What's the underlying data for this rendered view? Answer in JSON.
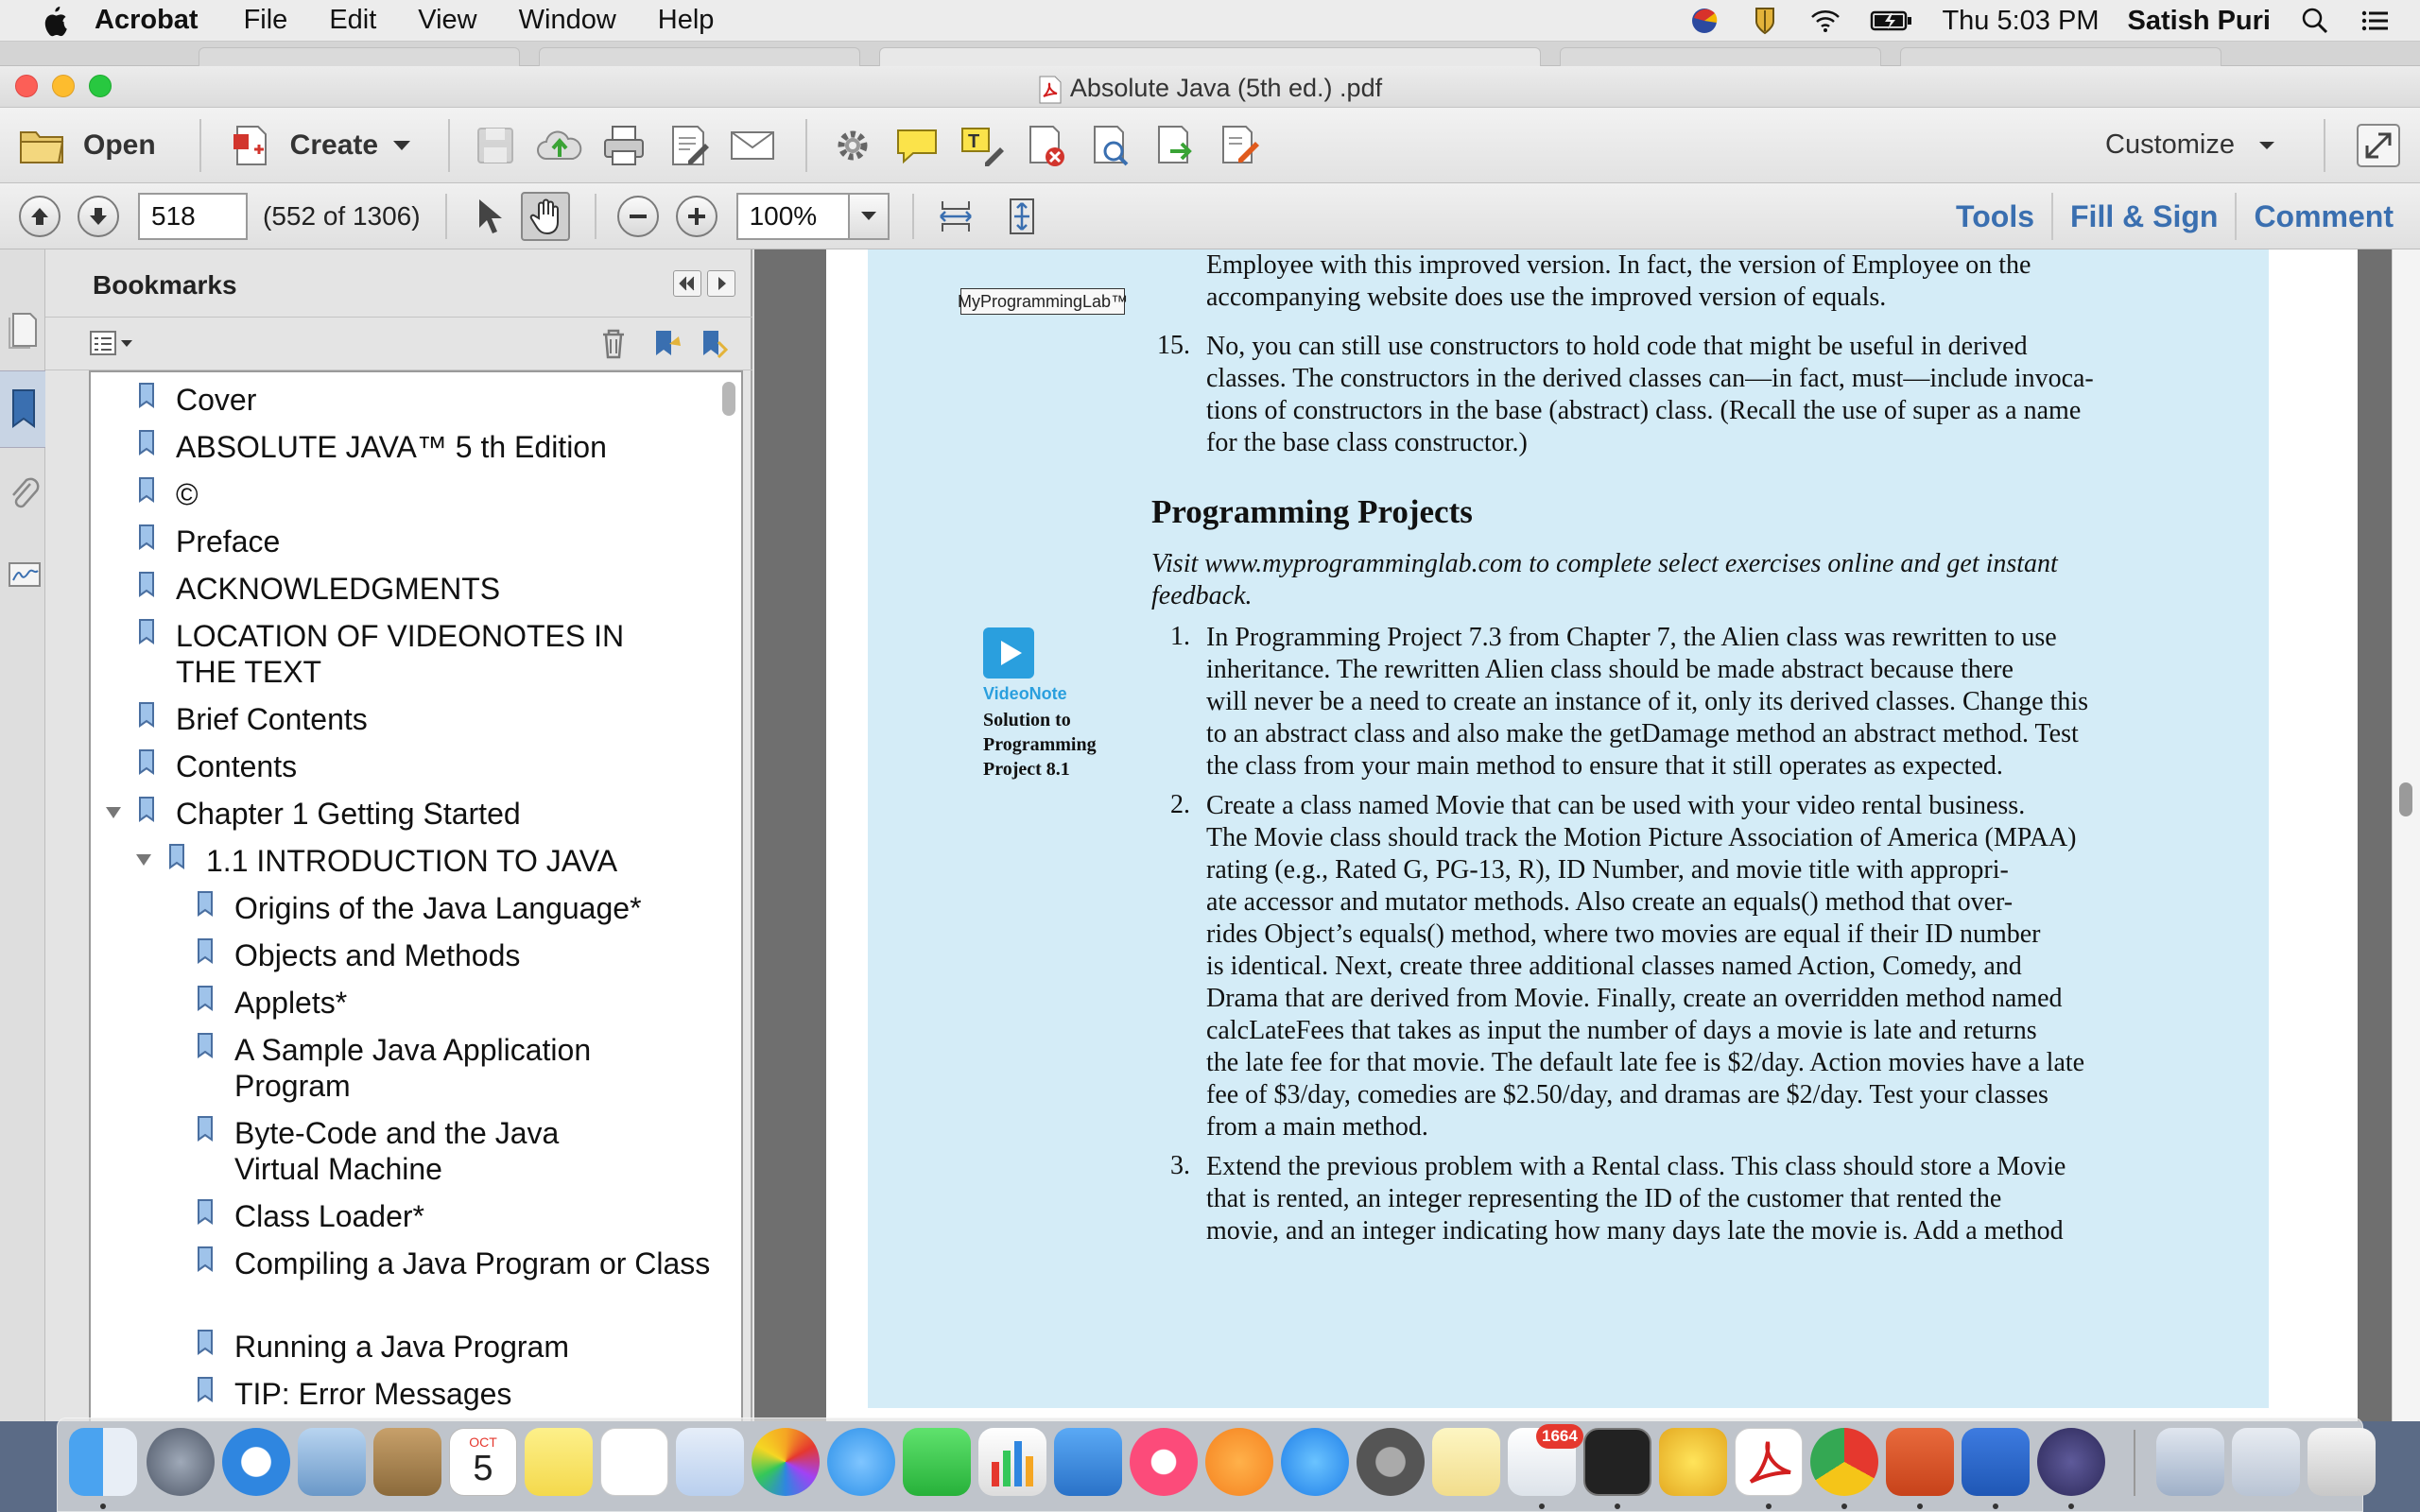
{
  "menubar": {
    "app": "Acrobat",
    "items": [
      "File",
      "Edit",
      "View",
      "Window",
      "Help"
    ],
    "clock": "Thu 5:03 PM",
    "user": "Satish Puri"
  },
  "window": {
    "title": "Absolute Java (5th ed.) .pdf"
  },
  "toolbar": {
    "open_label": "Open",
    "create_label": "Create",
    "customize_label": "Customize"
  },
  "nav": {
    "page_value": "518",
    "page_count": "(552 of 1306)",
    "zoom": "100%",
    "tools": "Tools",
    "fill_sign": "Fill & Sign",
    "comment": "Comment"
  },
  "bookmarks": {
    "title": "Bookmarks",
    "items": [
      {
        "label": "Cover"
      },
      {
        "label": "ABSOLUTE JAVA™ 5 th Edition"
      },
      {
        "label": "©"
      },
      {
        "label": "Preface"
      },
      {
        "label": "ACKNOWLEDGMENTS"
      },
      {
        "label": "LOCATION OF VIDEONOTES IN THE TEXT"
      },
      {
        "label": "Brief Contents"
      },
      {
        "label": "Contents"
      },
      {
        "label": "Chapter 1 Getting Started"
      },
      {
        "label": "1.1 INTRODUCTION TO JAVA"
      },
      {
        "label": "Origins of the Java Language*"
      },
      {
        "label": "Objects and Methods"
      },
      {
        "label": "Applets*"
      },
      {
        "label": "A Sample Java Application Program"
      },
      {
        "label": "Byte-Code and the Java Virtual Machine"
      },
      {
        "label": "Class Loader*"
      },
      {
        "label": "Compiling a Java Program or Class"
      },
      {
        "label": "Running a Java Program"
      },
      {
        "label": "TIP: Error Messages"
      }
    ]
  },
  "doc": {
    "top_line1": "Employee with this improved version. In fact, the version of Employee on the",
    "top_line2": "accompanying website does use the improved version of equals.",
    "item15_num": "15.",
    "item15": [
      "No, you can still use constructors to hold code that might be useful in derived",
      "classes. The constructors in the derived classes can—in fact, must—include invoca-",
      "tions of constructors in the base (abstract) class. (Recall the use of super as a name",
      "for the base class constructor.)"
    ],
    "logo": "MyProgrammingLab™",
    "heading": "Programming Projects",
    "intro": [
      "Visit www.myprogramminglab.com to complete select exercises online and get instant",
      "feedback."
    ],
    "videonote_label": "VideoNote",
    "videonote_desc": "Solution to Programming Project 8.1",
    "p1_num": "1.",
    "p1": [
      "In Programming Project 7.3 from Chapter 7, the Alien class was rewritten to use",
      "inheritance. The rewritten Alien class should be made abstract because there",
      "will never be a need to create an instance of it, only its derived classes. Change this",
      "to an abstract class and also make the getDamage method an abstract method. Test",
      "the class from your main method to ensure that it still operates as expected."
    ],
    "p2_num": "2.",
    "p2": [
      "Create a class named Movie that can be used with your video rental business.",
      "The Movie class should track the Motion Picture Association of America (MPAA)",
      "rating (e.g., Rated G, PG-13, R), ID Number, and movie title with appropri-",
      "ate accessor and mutator methods. Also create an equals() method that over-",
      "rides Object’s equals() method, where two movies are equal if their ID number",
      "is identical. Next, create three additional classes named Action, Comedy, and",
      "Drama that are derived from Movie. Finally, create an overridden method named",
      "calcLateFees that takes as input the number of days a movie is late and returns",
      "the late fee for that movie. The default late fee is $2/day. Action movies have a late",
      "fee of $3/day, comedies are $2.50/day, and dramas are $2/day. Test your classes",
      "from a main method."
    ],
    "p3_num": "3.",
    "p3": [
      "Extend the previous problem with a Rental class. This class should store a Movie",
      "that is rented, an integer representing the ID of the customer that rented the",
      "movie, and an integer indicating how many days late the movie is. Add a method"
    ]
  },
  "dock": {
    "mail_badge": "1664",
    "calendar_month": "OCT",
    "calendar_day": "5"
  },
  "colors": {
    "page_tint": "#d4ecf7",
    "link_blue": "#3a6fb0",
    "videonote_blue": "#2a9fde"
  }
}
